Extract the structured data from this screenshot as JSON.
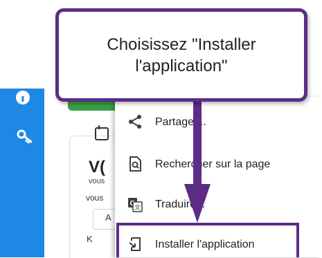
{
  "callout": {
    "text": "Choisissez \"Installer\nl'application\""
  },
  "background": {
    "title_fragment": "V(",
    "line1": "vous",
    "line2": "vous",
    "box_letter": "A",
    "k_letter": "K"
  },
  "menu": {
    "items": [
      {
        "label": "Partager...",
        "icon": "share-icon"
      },
      {
        "label": "Rechercher sur la page",
        "icon": "find-in-page-icon"
      },
      {
        "label": "Traduire...",
        "icon": "translate-icon"
      },
      {
        "label": "Installer l'application",
        "icon": "install-app-icon"
      }
    ]
  },
  "sidebar": {
    "icons": [
      "info-icon",
      "key-icon"
    ]
  },
  "colors": {
    "sidebar": "#1e88e5",
    "annotation_purple": "#5c2c86",
    "green_chip": "#3aa047"
  }
}
